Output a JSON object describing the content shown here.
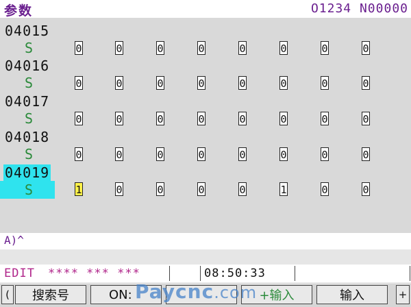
{
  "header": {
    "title": "参数",
    "program": "O1234 N00000"
  },
  "params": [
    {
      "number": "04015",
      "axis": "S",
      "bits": [
        "0",
        "0",
        "0",
        "0",
        "0",
        "0",
        "0",
        "0"
      ]
    },
    {
      "number": "04016",
      "axis": "S",
      "bits": [
        "0",
        "0",
        "0",
        "0",
        "0",
        "0",
        "0",
        "0"
      ]
    },
    {
      "number": "04017",
      "axis": "S",
      "bits": [
        "0",
        "0",
        "0",
        "0",
        "0",
        "0",
        "0",
        "0"
      ]
    },
    {
      "number": "04018",
      "axis": "S",
      "bits": [
        "0",
        "0",
        "0",
        "0",
        "0",
        "0",
        "0",
        "0"
      ]
    },
    {
      "number": "04019",
      "axis": "S",
      "bits": [
        "1",
        "0",
        "0",
        "0",
        "0",
        "1",
        "0",
        "0"
      ],
      "selected": true
    }
  ],
  "input": {
    "prompt": "A)^"
  },
  "status": {
    "mode": "EDIT",
    "stars": "**** ***  ***",
    "time": "08:50:33"
  },
  "softkeys": {
    "left_arrow": "(",
    "search": "搜索号",
    "on": "ON:",
    "input_plus": "+输入",
    "input": "输入",
    "right_arrow": "+"
  },
  "watermark": {
    "text": "Paycnc",
    "suffix": ".com"
  }
}
